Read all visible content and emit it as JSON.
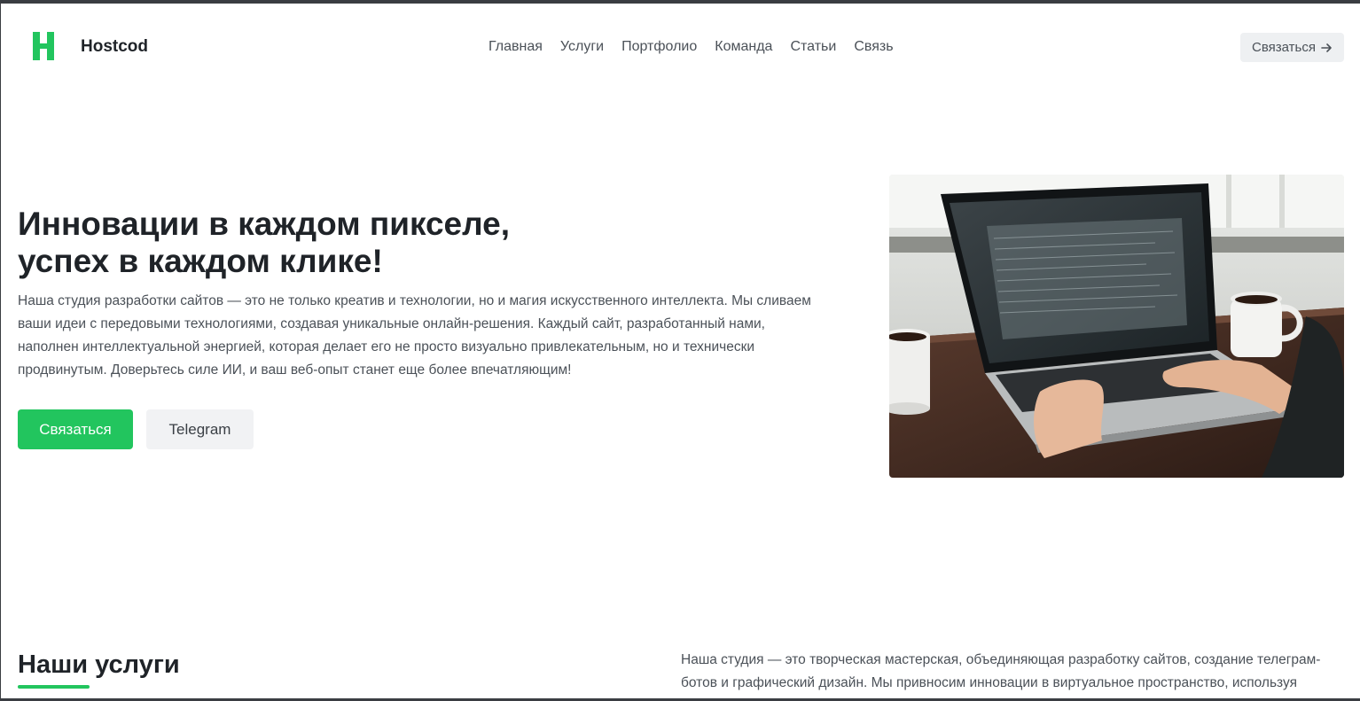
{
  "header": {
    "brand": "Hostcod",
    "nav": [
      "Главная",
      "Услуги",
      "Портфолио",
      "Команда",
      "Статьи",
      "Связь"
    ],
    "cta_label": "Связаться",
    "cta_icon": "arrow-right-icon"
  },
  "hero": {
    "title_line1": "Инновации в каждом пикселе,",
    "title_line2": "успех в каждом клике!",
    "text": "Наша студия разработки сайтов — это не только креатив и технологии, но и магия искусственного интеллекта. Мы сливаем ваши идеи с передовыми технологиями, создавая уникальные онлайн-решения. Каждый сайт, разработанный нами, наполнен интеллектуальной энергией, которая делает его не просто визуально привлекательным, но и технически продвинутым. Доверьтесь силе ИИ, и ваш веб-опыт станет еще более впечатляющим!",
    "primary_button": "Связаться",
    "secondary_button": "Telegram"
  },
  "services": {
    "title": "Наши услуги",
    "text": "Наша студия — это творческая мастерская, объединяющая разработку сайтов, создание телеграм-ботов и графический дизайн. Мы привносим инновации в виртуальное пространство, используя"
  },
  "colors": {
    "accent": "#22c55e",
    "text_dark": "#1f2328",
    "text_muted": "#4b5158"
  }
}
